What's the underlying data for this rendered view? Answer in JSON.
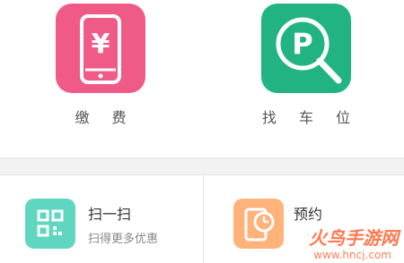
{
  "tiles": [
    {
      "label": "缴 费",
      "icon": "yen-phone-icon",
      "color": "#ef5a86"
    },
    {
      "label": "找 车 位",
      "icon": "parking-search-icon",
      "color": "#22b383"
    }
  ],
  "cards": [
    {
      "title": "扫一扫",
      "subtitle": "扫得更多优惠",
      "icon": "scan-icon",
      "color": "#5fd6c0"
    },
    {
      "title": "预约",
      "subtitle": "",
      "icon": "phone-clock-icon",
      "color": "#ffb37a"
    }
  ],
  "watermark": {
    "text": "火鸟手游网",
    "url": "www.hncj.com",
    "color": "#ff6a3d"
  }
}
